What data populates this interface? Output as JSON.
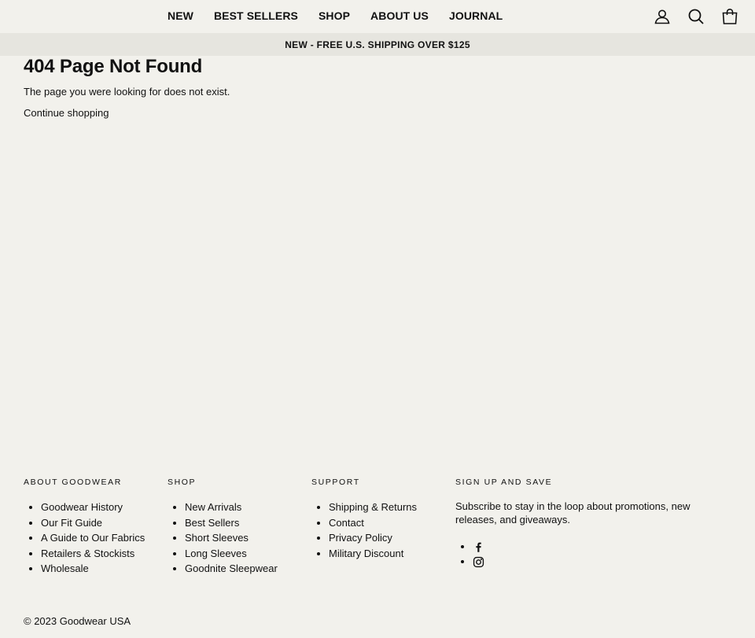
{
  "nav": {
    "items": [
      {
        "label": "NEW"
      },
      {
        "label": "BEST SELLERS"
      },
      {
        "label": "SHOP"
      },
      {
        "label": "ABOUT US"
      },
      {
        "label": "JOURNAL"
      }
    ],
    "icons": [
      "user-icon",
      "search-icon",
      "cart-icon"
    ]
  },
  "announcement": "NEW - FREE U.S. SHIPPING OVER $125",
  "main": {
    "title": "404 Page Not Found",
    "message": "The page you were looking for does not exist.",
    "continue_link": "Continue shopping"
  },
  "footer": {
    "about": {
      "heading": "ABOUT GOODWEAR",
      "links": [
        "Goodwear History",
        "Our Fit Guide",
        "A Guide to Our Fabrics",
        "Retailers & Stockists",
        "Wholesale"
      ]
    },
    "shop": {
      "heading": "SHOP",
      "links": [
        "New Arrivals",
        "Best Sellers",
        "Short Sleeves",
        "Long Sleeves",
        "Goodnite Sleepwear"
      ]
    },
    "support": {
      "heading": "SUPPORT",
      "links": [
        "Shipping & Returns",
        "Contact",
        "Privacy Policy",
        "Military Discount"
      ]
    },
    "signup": {
      "heading": "SIGN UP AND SAVE",
      "text": "Subscribe to stay in the loop about promotions, new releases, and giveaways.",
      "social_icons": [
        "facebook-icon",
        "instagram-icon"
      ]
    },
    "copyright": "© 2023 Goodwear USA"
  },
  "colors": {
    "background": "#f2f1ec",
    "announcement_bg": "#e6e5df",
    "text": "#111111"
  }
}
